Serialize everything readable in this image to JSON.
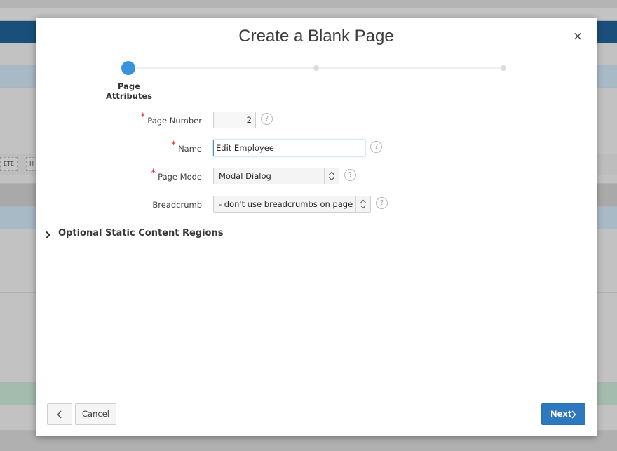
{
  "background": {
    "button_fragment_1": "ETE",
    "button_fragment_2": "H"
  },
  "dialog": {
    "title": "Create a Blank Page",
    "close_icon": "close-icon",
    "close_glyph": "×"
  },
  "wizard": {
    "active_step_label": "Page Attributes",
    "step_count": 3,
    "active_step_index": 1,
    "accent_color": "#3a94dd"
  },
  "form": {
    "page_number": {
      "label": "Page Number",
      "required_marker": "*",
      "value": "2",
      "help_glyph": "?"
    },
    "name": {
      "label": "Name",
      "required_marker": "*",
      "value": "Edit Employee",
      "help_glyph": "?"
    },
    "page_mode": {
      "label": "Page Mode",
      "required_marker": "*",
      "selected": "Modal Dialog",
      "help_glyph": "?"
    },
    "breadcrumb": {
      "label": "Breadcrumb",
      "selected": "- don't use breadcrumbs on page -",
      "help_glyph": "?"
    }
  },
  "regions": {
    "optional_static_title": "Optional Static Content Regions"
  },
  "footer": {
    "cancel_label": "Cancel",
    "next_label": "Next",
    "next_color": "#2e78bf"
  }
}
